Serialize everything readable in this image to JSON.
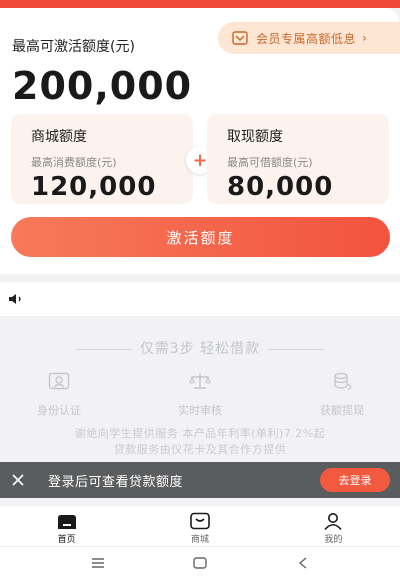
{
  "header": {
    "max_title": "最高可激活额度(元)",
    "vip_text": "会员专属高额低息",
    "vip_arrow": "›",
    "amount": "200,000"
  },
  "mall_quota": {
    "title": "商城额度",
    "label": "最高消费额度(元)",
    "value": "120,000"
  },
  "cash_quota": {
    "title": "取现额度",
    "label": "最高可借额度(元)",
    "value": "80,000"
  },
  "plus_symbol": "+",
  "activate_button": "激活额度",
  "steps": {
    "title": "仅需3步 轻松借款",
    "items": [
      {
        "label": "身份认证",
        "icon": "id-card-icon"
      },
      {
        "label": "实时审核",
        "icon": "scale-icon"
      },
      {
        "label": "获额提现",
        "icon": "coins-icon"
      }
    ]
  },
  "disclaimer": {
    "line1": "谢绝向学生提供服务 本产品年利率(单利)7.2%起",
    "line2": "贷款服务由仪花卡及其合作方提供"
  },
  "login_bar": {
    "text": "登录后可查看贷款额度",
    "button": "去登录"
  },
  "tabs": [
    {
      "label": "首页",
      "icon": "home-icon",
      "active": true
    },
    {
      "label": "商城",
      "icon": "shop-icon",
      "active": false
    },
    {
      "label": "我的",
      "icon": "profile-icon",
      "active": false
    }
  ],
  "colors": {
    "accent": "#f2533e",
    "vip_bg": "#fde7d4",
    "vip_text": "#c9692c",
    "sub_card_bg": "#fdf3ee"
  }
}
